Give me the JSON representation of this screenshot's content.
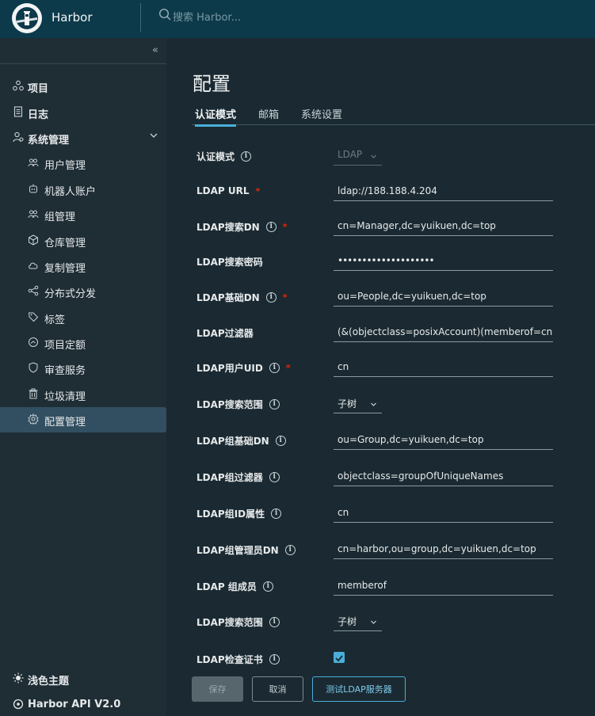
{
  "header": {
    "brand": "Harbor",
    "search_placeholder": "搜索 Harbor..."
  },
  "sidebar": {
    "collapse_glyph": "«",
    "items": [
      {
        "label": "项目",
        "icon": "projects-icon"
      },
      {
        "label": "日志",
        "icon": "logs-icon"
      },
      {
        "label": "系统管理",
        "icon": "admin-icon"
      }
    ],
    "sub_items": [
      {
        "label": "用户管理",
        "icon": "users-icon"
      },
      {
        "label": "机器人账户",
        "icon": "robot-icon"
      },
      {
        "label": "组管理",
        "icon": "groups-icon"
      },
      {
        "label": "仓库管理",
        "icon": "registry-icon"
      },
      {
        "label": "复制管理",
        "icon": "cloud-icon"
      },
      {
        "label": "分布式分发",
        "icon": "share-icon"
      },
      {
        "label": "标签",
        "icon": "tag-icon"
      },
      {
        "label": "项目定额",
        "icon": "quota-icon"
      },
      {
        "label": "审查服务",
        "icon": "shield-icon"
      },
      {
        "label": "垃圾清理",
        "icon": "trash-icon"
      },
      {
        "label": "配置管理",
        "icon": "gear-icon"
      }
    ],
    "theme_label": "浅色主题",
    "api_label": "Harbor API V2.0"
  },
  "main": {
    "title": "配置",
    "tabs": [
      "认证模式",
      "邮箱",
      "系统设置"
    ]
  },
  "form": {
    "auth_mode": {
      "label": "认证模式",
      "value": "LDAP"
    },
    "ldap_url": {
      "label": "LDAP URL",
      "value": "ldap://188.188.4.204"
    },
    "search_dn": {
      "label": "LDAP搜索DN",
      "value": "cn=Manager,dc=yuikuen,dc=top"
    },
    "search_pwd": {
      "label": "LDAP搜索密码",
      "value": "••••••••••••••••••••"
    },
    "base_dn": {
      "label": "LDAP基础DN",
      "value": "ou=People,dc=yuikuen,dc=top"
    },
    "filter": {
      "label": "LDAP过滤器",
      "value": "(&(objectclass=posixAccount)(memberof=cn=harbor"
    },
    "uid": {
      "label": "LDAP用户UID",
      "value": "cn"
    },
    "scope": {
      "label": "LDAP搜索范围",
      "value": "子树"
    },
    "group_base_dn": {
      "label": "LDAP组基础DN",
      "value": "ou=Group,dc=yuikuen,dc=top"
    },
    "group_filter": {
      "label": "LDAP组过滤器",
      "value": "objectclass=groupOfUniqueNames"
    },
    "group_gid": {
      "label": "LDAP组ID属性",
      "value": "cn"
    },
    "group_admin_dn": {
      "label": "LDAP组管理员DN",
      "value": "cn=harbor,ou=group,dc=yuikuen,dc=top"
    },
    "group_member": {
      "label": "LDAP 组成员",
      "value": "memberof"
    },
    "group_scope": {
      "label": "LDAP搜索范围",
      "value": "子树"
    },
    "verify_cert": {
      "label": "LDAP检查证书",
      "checked": true
    }
  },
  "buttons": {
    "save": "保存",
    "cancel": "取消",
    "test": "测试LDAP服务器"
  },
  "colors": {
    "header_bg": "#0c3a4a",
    "sidebar_bg": "#1f2d35",
    "main_bg": "#1b2a32",
    "accent": "#49afd9",
    "required": "#e62700"
  }
}
